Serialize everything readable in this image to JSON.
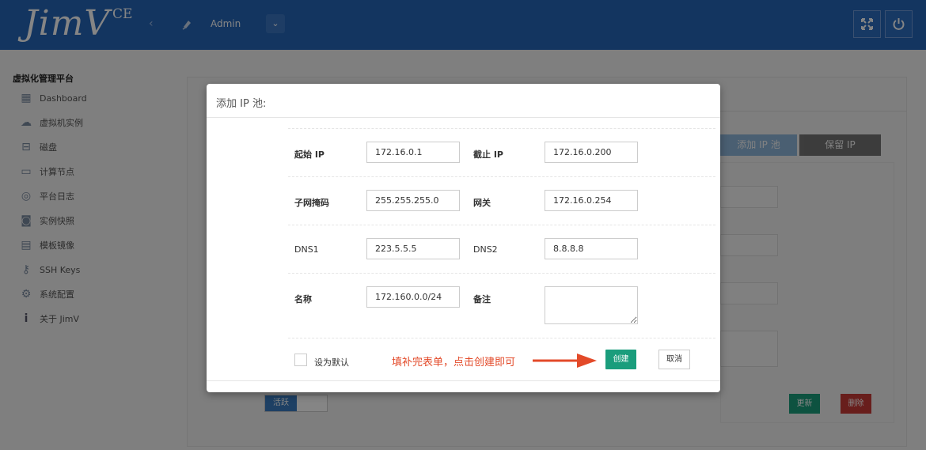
{
  "header": {
    "logo_text": "JimV",
    "logo_suffix": "CE",
    "collapse_icon": "chevron-left-icon",
    "user_name": "Admin",
    "user_menu_icon": "chevron-down-icon",
    "fullscreen_icon": "expand-icon",
    "power_icon": "power-icon"
  },
  "sidebar": {
    "title": "虚拟化管理平台",
    "items": [
      {
        "label": "Dashboard",
        "icon": "dashboard-icon"
      },
      {
        "label": "虚拟机实例",
        "icon": "cloud-icon"
      },
      {
        "label": "磁盘",
        "icon": "disk-icon"
      },
      {
        "label": "计算节点",
        "icon": "monitor-icon"
      },
      {
        "label": "平台日志",
        "icon": "eye-icon"
      },
      {
        "label": "实例快照",
        "icon": "camera-icon"
      },
      {
        "label": "模板镜像",
        "icon": "image-icon"
      },
      {
        "label": "SSH Keys",
        "icon": "key-icon"
      },
      {
        "label": "系统配置",
        "icon": "gear-icon"
      },
      {
        "label": "关于 JimV",
        "icon": "info-icon"
      }
    ]
  },
  "background": {
    "add_ip_pool_tab": "添加 IP 池",
    "reserve_ip_tab": "保留 IP",
    "status_label": "活跃",
    "update_button": "更新",
    "delete_button": "删除"
  },
  "modal": {
    "title": "添加 IP 池:",
    "start_ip_label": "起始 IP",
    "start_ip_value": "172.16.0.1",
    "end_ip_label": "截止 IP",
    "end_ip_value": "172.16.0.200",
    "netmask_label": "子网掩码",
    "netmask_value": "255.255.255.0",
    "gateway_label": "网关",
    "gateway_value": "172.16.0.254",
    "dns1_label": "DNS1",
    "dns1_value": "223.5.5.5",
    "dns2_label": "DNS2",
    "dns2_value": "8.8.8.8",
    "name_label": "名称",
    "name_value": "172.160.0.0/24",
    "remark_label": "备注",
    "remark_value": "",
    "default_label": "设为默认",
    "annotation": "填补完表单，点击创建即可",
    "create_button": "创建",
    "cancel_button": "取消"
  },
  "colors": {
    "header_bg": "#2566b8",
    "create_green": "#1a9d7c",
    "delete_red": "#c73a36",
    "annotation_red": "#e34a29"
  }
}
